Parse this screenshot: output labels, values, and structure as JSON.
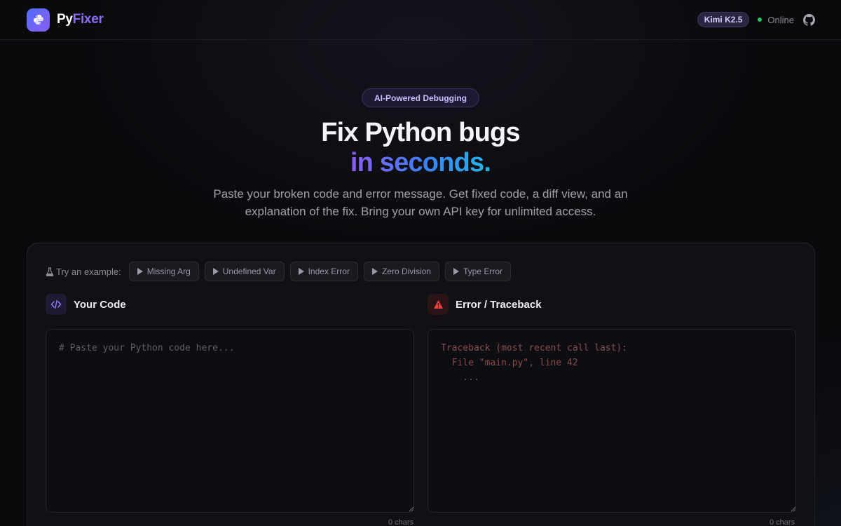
{
  "header": {
    "brand_prefix": "Py",
    "brand_suffix": "Fixer",
    "model_badge": "Kimi K2.5",
    "status": "Online"
  },
  "hero": {
    "pill": "AI-Powered Debugging",
    "title_line1": "Fix Python bugs",
    "title_line2": "in seconds.",
    "subtitle": "Paste your broken code and error message. Get fixed code, a diff view, and an explanation of the fix. Bring your own API key for unlimited access."
  },
  "examples": {
    "label": "Try an example:",
    "items": [
      "Missing Arg",
      "Undefined Var",
      "Index Error",
      "Zero Division",
      "Type Error"
    ]
  },
  "code_panel": {
    "title": "Your Code",
    "placeholder": "# Paste your Python code here...",
    "char_count": "0 chars"
  },
  "error_panel": {
    "title": "Error / Traceback",
    "placeholder": "Traceback (most recent call last):\n  File \"main.py\", line 42\n    ...",
    "char_count": "0 chars"
  },
  "colors": {
    "accent": "#8b5cf6",
    "status_online": "#22c55e",
    "error": "#ef4444"
  },
  "icons": {
    "logo": "python-icon",
    "github": "github-icon",
    "examples": "flask-icon",
    "code": "code-icon",
    "error": "warning-icon"
  }
}
